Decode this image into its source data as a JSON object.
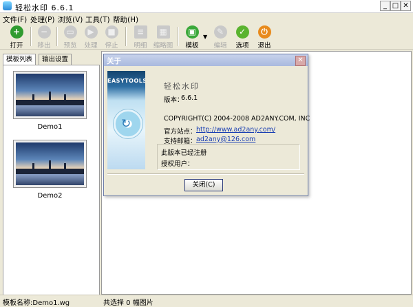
{
  "window": {
    "title": "轻松水印 6.6.1"
  },
  "menu": [
    "文件(F)",
    "处理(P)",
    "浏览(V)",
    "工具(T)",
    "帮助(H)"
  ],
  "toolbar": {
    "open": "打开",
    "remove": "移出",
    "preview": "预览",
    "process": "处理",
    "stop": "停止",
    "details": "明细",
    "thumbnail": "缩略图",
    "template": "模板",
    "edit": "编辑",
    "options": "选项",
    "exit": "退出"
  },
  "left_panel": {
    "tabs": [
      "模板列表",
      "输出设置"
    ],
    "templates": [
      {
        "name": "Demo1"
      },
      {
        "name": "Demo2"
      }
    ]
  },
  "about_dialog": {
    "title": "关于",
    "brand": "EASYTOOLS",
    "product_name": "轻松水印",
    "version_label": "版本：",
    "version": "6.6.1",
    "copyright": "COPYRIGHT(C) 2004-2008 AD2ANY.COM, INC",
    "website_label": "官方站点：",
    "website": "http://www.ad2any.com/",
    "email_label": "支持邮箱：",
    "email": "ad2any@126.com",
    "registered_text": "此版本已经注册",
    "licensed_user_label": "授权用户：",
    "licensed_user": "",
    "close_button": "关闭(C)"
  },
  "status": {
    "template_name": "模板名称:Demo1.wg",
    "selection": "共选择 0 幅图片"
  },
  "colors": {
    "open": "#2f9b2f",
    "remove": "#8e8e8e",
    "template": "#3aa83a",
    "options": "#5ab32f",
    "exit": "#e88a1c"
  }
}
